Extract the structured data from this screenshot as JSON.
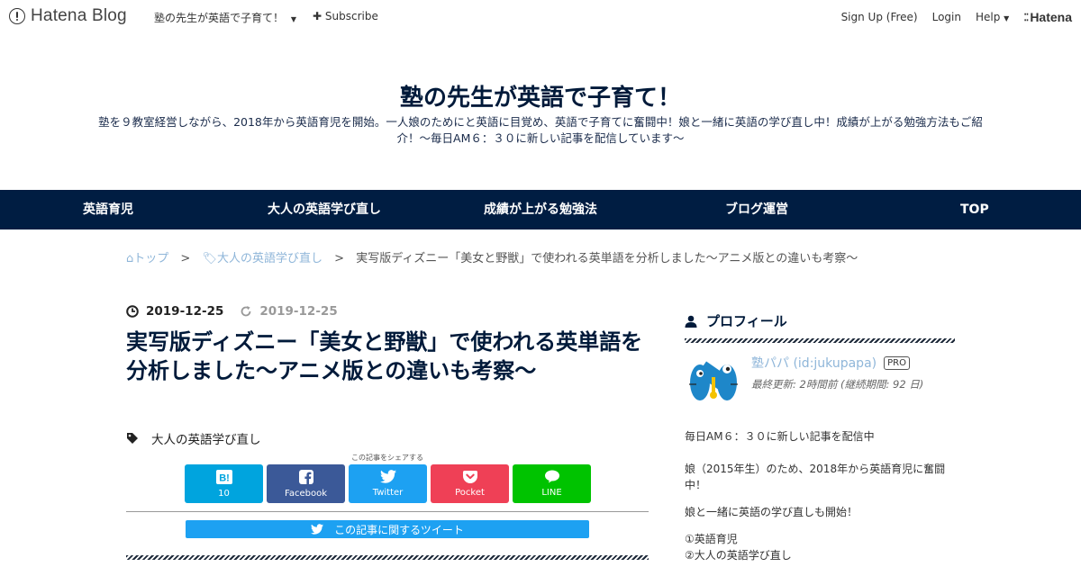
{
  "topbar": {
    "logo_text": "Hatena Blog",
    "blog_select": "塾の先生が英語で子育て！",
    "subscribe": "Subscribe",
    "signup": "Sign Up (Free)",
    "login": "Login",
    "help": "Help",
    "brand": "Hatena"
  },
  "header": {
    "title": "塾の先生が英語で子育て！",
    "description": "塾を９教室経営しながら、2018年から英語育児を開始。一人娘のためにと英語に目覚め、英語で子育てに奮闘中！娘と一緒に英語の学び直し中！成績が上がる勉強方法もご紹介！～毎日AM６：３０に新しい記事を配信しています～"
  },
  "nav": {
    "items": [
      "英語育児",
      "大人の英語学び直し",
      "成績が上がる勉強法",
      "ブログ運営",
      "TOP"
    ]
  },
  "breadcrumb": {
    "home": "トップ",
    "category": "大人の英語学び直し",
    "current": "実写版ディズニー「美女と野獣」で使われる英単語を分析しました～アニメ版との違いも考察～",
    "sep": ">"
  },
  "article": {
    "published": "2019-12-25",
    "updated": "2019-12-25",
    "title": "実写版ディズニー「美女と野獣」で使われる英単語を分析しました～アニメ版との違いも考察～",
    "category": "大人の英語学び直し",
    "share_caption": "この記事をシェアする",
    "share": {
      "hatena": {
        "label": "10",
        "color": "#00a4de"
      },
      "facebook": {
        "label": "Facebook",
        "color": "#3b5998"
      },
      "twitter": {
        "label": "Twitter",
        "color": "#1da1f2"
      },
      "pocket": {
        "label": "Pocket",
        "color": "#ef4056"
      },
      "line": {
        "label": "LINE",
        "color": "#00c300"
      }
    },
    "tweet_bar": "この記事に関するツイート"
  },
  "sidebar": {
    "heading": "プロフィール",
    "name": "塾パパ (id:jukupapa)",
    "badge": "PRO",
    "last_update": "最終更新: 2時間前 (継続期間: 92 日)",
    "lines": [
      "毎日AM６：３０に新しい記事を配信中",
      "娘（2015年生）のため、2018年から英語育児に奮闘中！",
      "娘と一緒に英語の学び直しも開始！",
      "①英語育児",
      "②大人の英語学び直し"
    ]
  }
}
